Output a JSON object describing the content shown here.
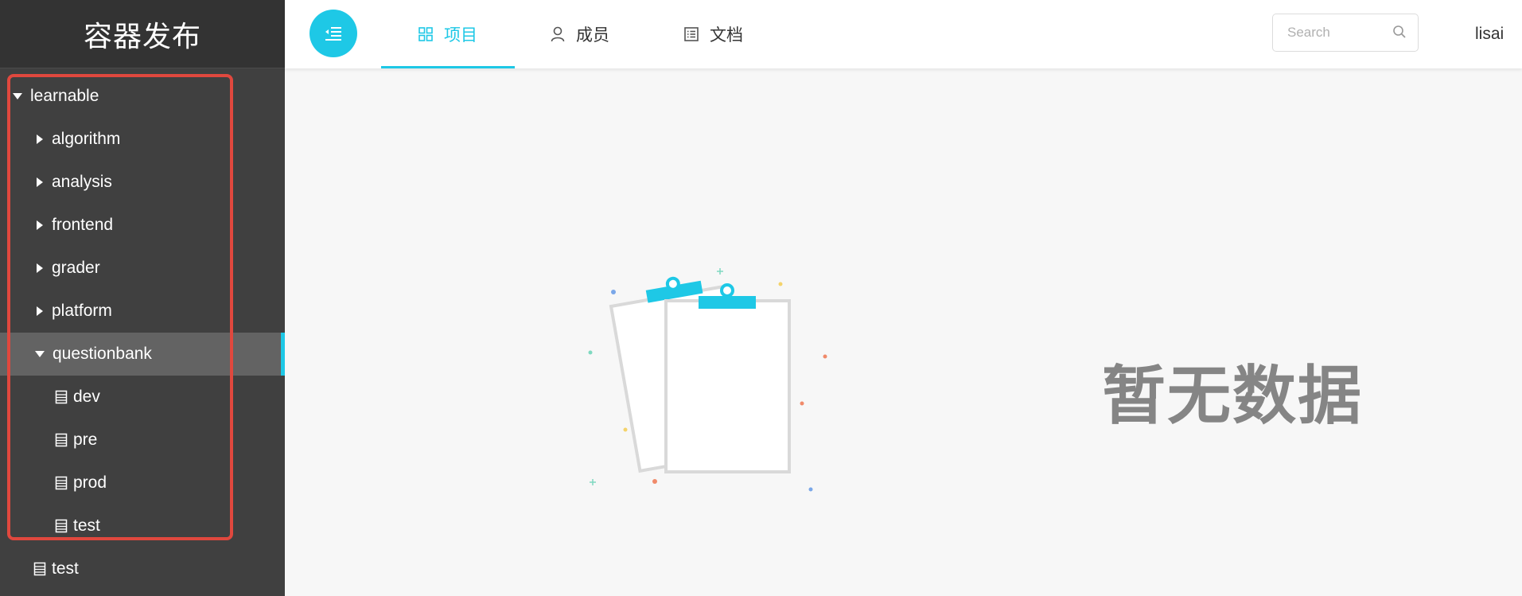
{
  "app": {
    "title": "容器发布"
  },
  "tree": {
    "items": [
      {
        "label": "learnable",
        "level": 0,
        "kind": "folder",
        "expanded": true
      },
      {
        "label": "algorithm",
        "level": 1,
        "kind": "folder",
        "expanded": false
      },
      {
        "label": "analysis",
        "level": 1,
        "kind": "folder",
        "expanded": false
      },
      {
        "label": "frontend",
        "level": 1,
        "kind": "folder",
        "expanded": false
      },
      {
        "label": "grader",
        "level": 1,
        "kind": "folder",
        "expanded": false
      },
      {
        "label": "platform",
        "level": 1,
        "kind": "folder",
        "expanded": false
      },
      {
        "label": "questionbank",
        "level": 1,
        "kind": "folder",
        "expanded": true,
        "selected": true
      },
      {
        "label": "dev",
        "level": 2,
        "kind": "file"
      },
      {
        "label": "pre",
        "level": 2,
        "kind": "file"
      },
      {
        "label": "prod",
        "level": 2,
        "kind": "file"
      },
      {
        "label": "test",
        "level": 2,
        "kind": "file"
      },
      {
        "label": "test",
        "level": 1,
        "kind": "file"
      }
    ]
  },
  "nav": {
    "menu_icon": "menu-collapse-icon",
    "tabs": [
      {
        "label": "项目",
        "icon": "grid-icon",
        "active": true
      },
      {
        "label": "成员",
        "icon": "user-icon",
        "active": false
      },
      {
        "label": "文档",
        "icon": "list-doc-icon",
        "active": false
      }
    ]
  },
  "search": {
    "placeholder": "Search",
    "value": ""
  },
  "user": {
    "name": "lisai"
  },
  "empty": {
    "text": "暂无数据",
    "icon": "clipboard-empty-icon"
  },
  "colors": {
    "accent": "#1ec8e6",
    "sidebar_bg": "#404040",
    "sidebar_header_bg": "#333333",
    "selected_bg": "#636363",
    "highlight_border": "#e0483e",
    "empty_text": "#858585"
  }
}
